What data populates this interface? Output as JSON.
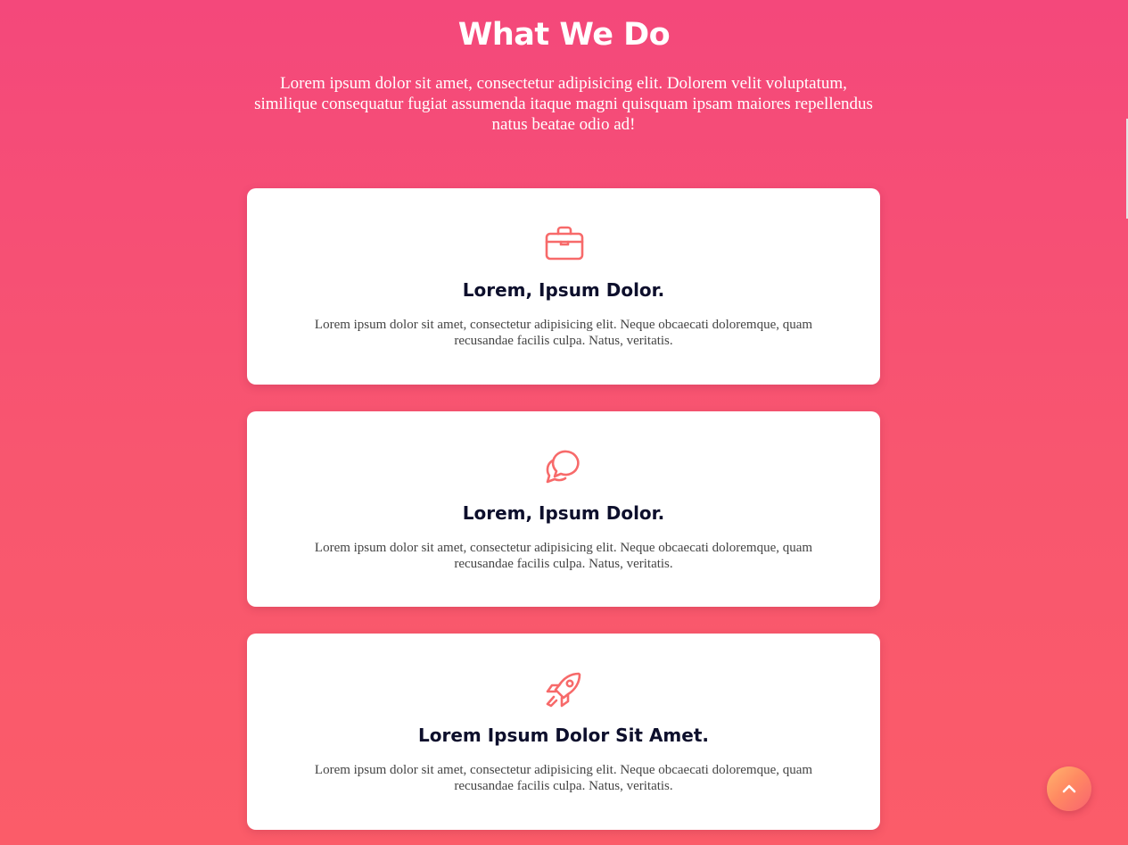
{
  "header": {
    "title": "What We Do",
    "description": "Lorem ipsum dolor sit amet, consectetur adipisicing elit. Dolorem velit voluptatum, similique consequatur fugiat assumenda itaque magni quisquam ipsam maiores repellendus natus beatae odio ad!"
  },
  "cards": [
    {
      "icon": "briefcase-icon",
      "title": "Lorem, Ipsum Dolor.",
      "text": "Lorem ipsum dolor sit amet, consectetur adipisicing elit. Neque obcaecati doloremque, quam recusandae facilis culpa. Natus, veritatis."
    },
    {
      "icon": "chat-bubbles-icon",
      "title": "Lorem, Ipsum Dolor.",
      "text": "Lorem ipsum dolor sit amet, consectetur adipisicing elit. Neque obcaecati doloremque, quam recusandae facilis culpa. Natus, veritatis."
    },
    {
      "icon": "rocket-icon",
      "title": "Lorem Ipsum Dolor Sit Amet.",
      "text": "Lorem ipsum dolor sit amet, consectetur adipisicing elit. Neque obcaecati doloremque, quam recusandae facilis culpa. Natus, veritatis."
    }
  ],
  "scroll_top": {
    "icon": "chevron-up-icon"
  },
  "colors": {
    "background_top": "#f4487b",
    "background_bottom": "#fb5c69",
    "icon_accent": "#f76a6a",
    "card_title": "#0d0f2c",
    "card_text": "#444444",
    "card_background": "#ffffff",
    "scroll_button_start": "#ffb56d",
    "scroll_button_end": "#f9636f"
  }
}
